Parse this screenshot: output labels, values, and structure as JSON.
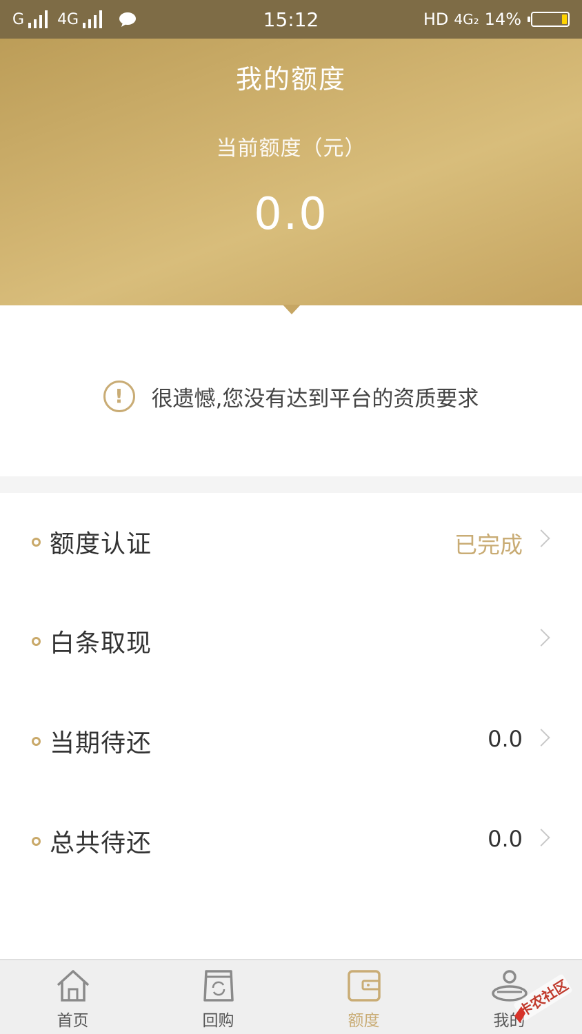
{
  "status_bar": {
    "carrier1": "G",
    "carrier2": "4G",
    "time": "15:12",
    "network": "HD",
    "network2": "4G₂",
    "battery": "14%",
    "battery_level": 0.14,
    "battery_color": "#ffd400",
    "icons": [
      "signal-icon",
      "signal-icon",
      "chat-icon",
      "battery-icon"
    ]
  },
  "header": {
    "title": "我的额度",
    "subtitle": "当前额度（元）",
    "amount": "0.0"
  },
  "notice": {
    "icon": "warning-icon",
    "text": "很遗憾,您没有达到平台的资质要求"
  },
  "menu": [
    {
      "label": "额度认证",
      "value": "已完成"
    },
    {
      "label": "白条取现",
      "value": ""
    },
    {
      "label": "当期待还",
      "value": "0.0"
    },
    {
      "label": "总共待还",
      "value": "0.0"
    }
  ],
  "tabs": [
    {
      "label": "首页",
      "icon": "home-icon"
    },
    {
      "label": "回购",
      "icon": "repurchase-icon"
    },
    {
      "label": "额度",
      "icon": "wallet-icon",
      "active": true
    },
    {
      "label": "我的",
      "icon": "profile-icon"
    }
  ],
  "watermark": "卡农社区",
  "colors": {
    "accent_gold": "#c9ac75",
    "header_gold": "#d2b572",
    "status_bar": "#7e6c46"
  }
}
